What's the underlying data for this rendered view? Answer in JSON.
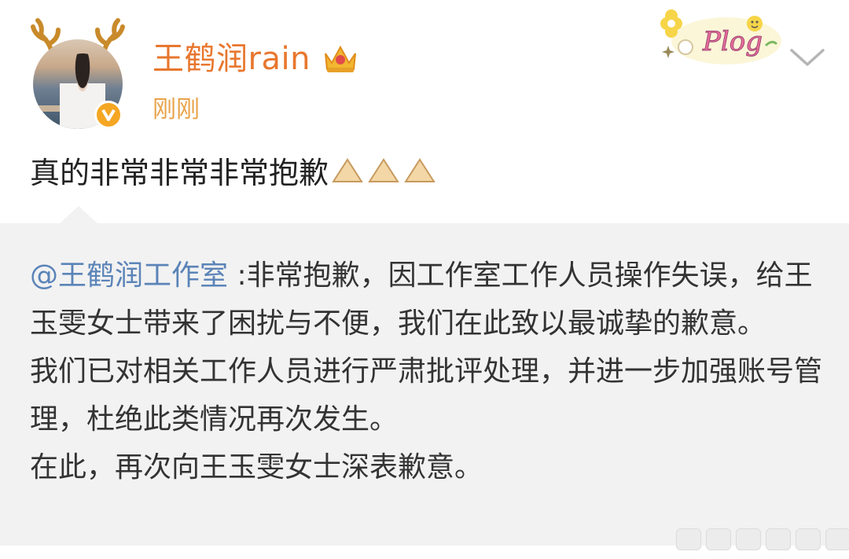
{
  "post": {
    "author": "王鹤润rain",
    "timestamp": "刚刚",
    "text": "真的非常非常非常抱歉"
  },
  "repost": {
    "mention": "@王鹤润工作室",
    "sep": " :",
    "line1": "非常抱歉，因工作室工作人员操作失误，给王玉雯女士带来了困扰与不便，我们在此致以最诚挚的歉意。",
    "line2": "我们已对相关工作人员进行严肃批评处理，并进一步加强账号管理，杜绝此类情况再次发生。",
    "line3": "在此，再次向王玉雯女士深表歉意。"
  },
  "sticker": {
    "text": "Plog"
  },
  "colors": {
    "username": "#e8772e",
    "timestamp": "#e8a34a",
    "mention": "#5b84b8",
    "repost_bg": "#f2f2f2"
  }
}
